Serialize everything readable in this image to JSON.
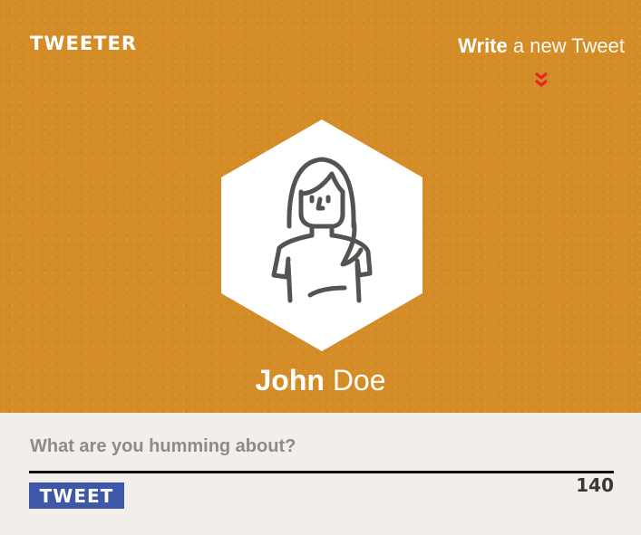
{
  "app": {
    "logo": "TWEETER"
  },
  "header": {
    "write_link_bold": "Write",
    "write_link_rest": "a new Tweet",
    "chevron_icon": "double-chevron-down-icon",
    "chevron_color": "#e02a1f"
  },
  "profile": {
    "first_name": "John",
    "last_name": "Doe",
    "avatar_icon": "woman-avatar-icon"
  },
  "compose": {
    "placeholder": "What are you humming about?",
    "value": "",
    "button_label": "TWEET",
    "char_count": "140"
  },
  "colors": {
    "hero_bg": "#d48c27",
    "compose_bg": "#f2efea",
    "button_bg": "#3f57a8",
    "text_dark": "#3a3836"
  }
}
